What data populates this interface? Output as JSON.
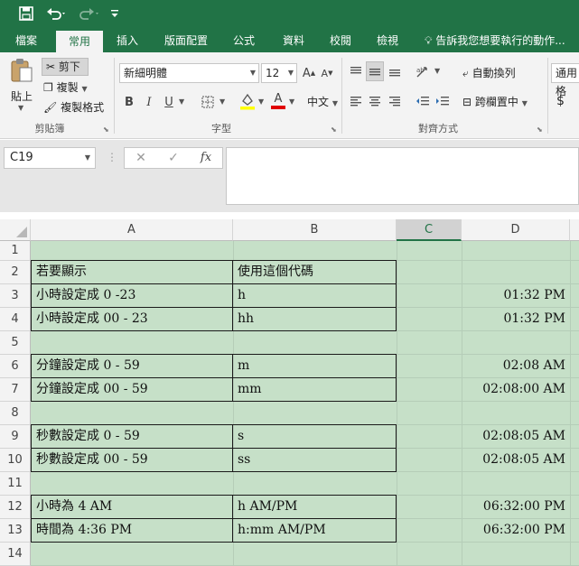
{
  "qat": {
    "save_icon": "save-icon",
    "undo_icon": "undo-icon",
    "redo_icon": "redo-icon",
    "customize_icon": "customize-icon"
  },
  "tabs": [
    {
      "label": "檔案"
    },
    {
      "label": "常用"
    },
    {
      "label": "插入"
    },
    {
      "label": "版面配置"
    },
    {
      "label": "公式"
    },
    {
      "label": "資料"
    },
    {
      "label": "校閱"
    },
    {
      "label": "檢視"
    }
  ],
  "tell_me": "告訴我您想要執行的動作...",
  "ribbon": {
    "clipboard": {
      "paste": "貼上",
      "cut": "剪下",
      "copy": "複製",
      "format_painter": "複製格式",
      "label": "剪貼簿"
    },
    "font": {
      "name": "新細明體",
      "size": "12",
      "bold": "B",
      "italic": "I",
      "underline": "U",
      "font_color": "A",
      "phonetic": "中文",
      "label": "字型"
    },
    "alignment": {
      "wrap": "自動換列",
      "merge": "跨欄置中",
      "label": "對齊方式"
    },
    "number": {
      "format": "通用格",
      "currency": "$"
    }
  },
  "formula_bar": {
    "name_box": "C19",
    "cancel": "✕",
    "enter": "✓",
    "fx": "fx",
    "value": ""
  },
  "columns": [
    "A",
    "B",
    "C",
    "D"
  ],
  "selected_column": "C",
  "rows": [
    {
      "n": "1",
      "a": "",
      "b": "",
      "d": ""
    },
    {
      "n": "2",
      "a": "若要顯示",
      "b": "使用這個代碼",
      "d": ""
    },
    {
      "n": "3",
      "a": "小時設定成 0 -23",
      "b": "h",
      "d": "01:32 PM"
    },
    {
      "n": "4",
      "a": "小時設定成 00 - 23",
      "b": "hh",
      "d": "01:32 PM"
    },
    {
      "n": "5",
      "a": "",
      "b": "",
      "d": ""
    },
    {
      "n": "6",
      "a": "分鐘設定成 0 - 59",
      "b": "m",
      "d": "02:08 AM"
    },
    {
      "n": "7",
      "a": "分鐘設定成 00 - 59",
      "b": "mm",
      "d": "02:08:00 AM"
    },
    {
      "n": "8",
      "a": "",
      "b": "",
      "d": ""
    },
    {
      "n": "9",
      "a": "秒數設定成 0 - 59",
      "b": "s",
      "d": "02:08:05 AM"
    },
    {
      "n": "10",
      "a": "秒數設定成 00 - 59",
      "b": "ss",
      "d": "02:08:05 AM"
    },
    {
      "n": "11",
      "a": "",
      "b": "",
      "d": ""
    },
    {
      "n": "12",
      "a": "小時為 4 AM",
      "b": "h AM/PM",
      "d": "06:32:00 PM"
    },
    {
      "n": "13",
      "a": "時間為 4:36 PM",
      "b": "h:mm AM/PM",
      "d": "06:32:00 PM"
    },
    {
      "n": "14",
      "a": "",
      "b": "",
      "d": ""
    }
  ],
  "colors": {
    "title_bar": "#217346",
    "sheet_fill": "#c6e0c8"
  }
}
